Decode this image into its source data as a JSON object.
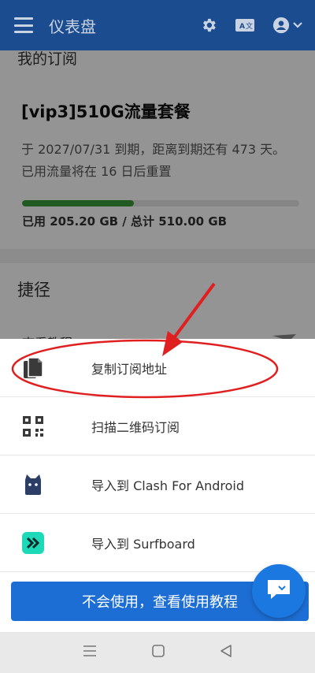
{
  "appbar": {
    "title": "仪表盘",
    "icons": [
      "menu-icon",
      "gear-icon",
      "translate-icon",
      "account-icon",
      "chevron-down-icon"
    ]
  },
  "subscription": {
    "section_title": "我的订阅",
    "plan_name": "[vip3]510G流量套餐",
    "expire_line": "于 2027/07/31 到期，距离到期还有 473 天。",
    "reset_line": "已用流量将在 16 日后重置",
    "usage_text": "已用 205.20 GB / 总计 510.00 GB",
    "usage_fraction": 0.4024
  },
  "shortcuts": {
    "section_title": "捷径",
    "first_item_partial": "查看教程"
  },
  "sheet": {
    "items": [
      {
        "label": "复制订阅地址",
        "icon": "copy-icon"
      },
      {
        "label": "扫描二维码订阅",
        "icon": "qr-code-icon"
      },
      {
        "label": "导入到 Clash For Android",
        "icon": "clash-cat-icon"
      },
      {
        "label": "导入到 Surfboard",
        "icon": "surfboard-icon"
      }
    ],
    "cta_label": "不会使用，查看使用教程"
  },
  "colors": {
    "appbar": "#1b4c8f",
    "cta": "#1d6ed4",
    "progress": "#3a9b3a",
    "annotation": "#e02020"
  }
}
